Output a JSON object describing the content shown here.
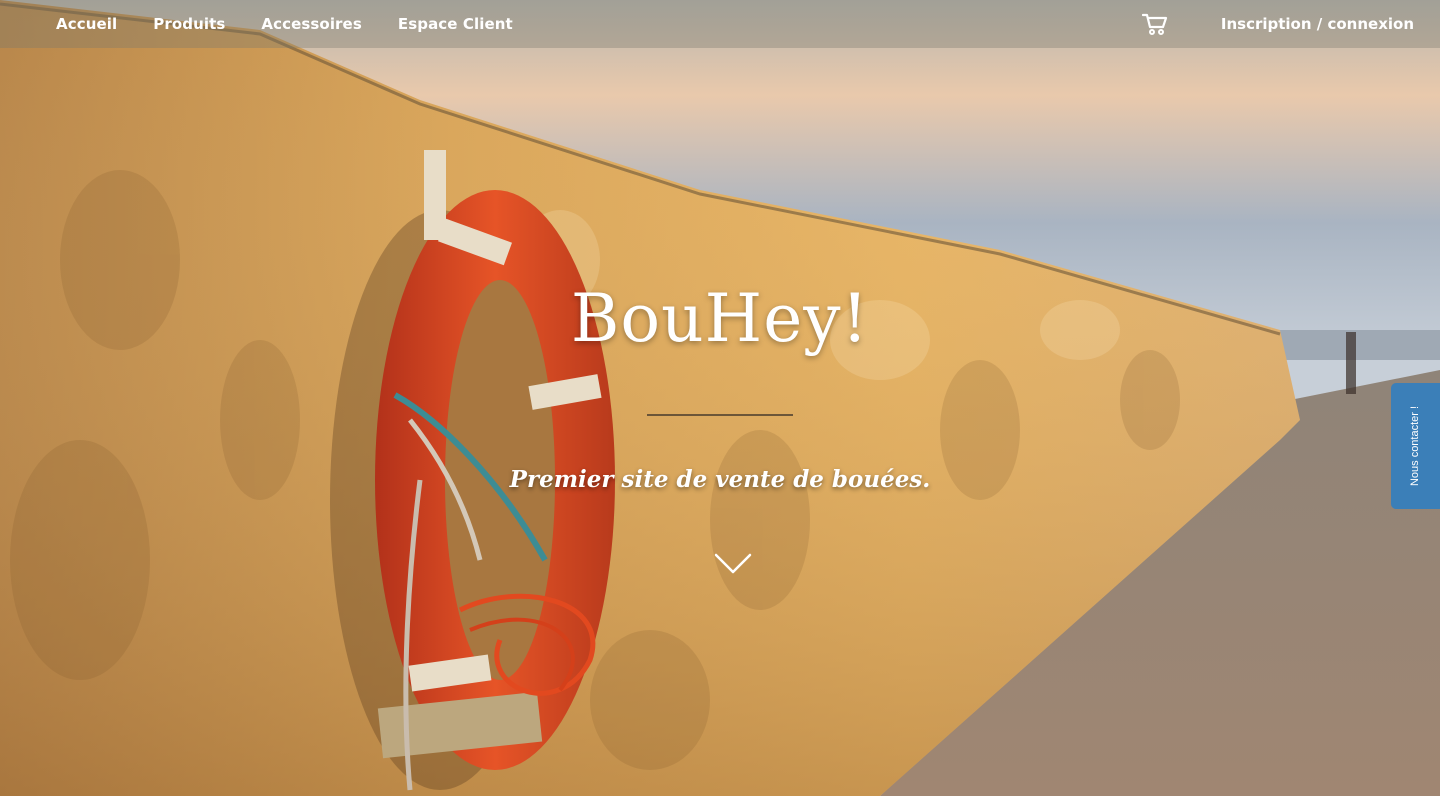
{
  "nav": {
    "items": [
      {
        "label": "Accueil"
      },
      {
        "label": "Produits"
      },
      {
        "label": "Accessoires"
      },
      {
        "label": "Espace Client"
      }
    ],
    "cart_icon": "shopping-cart-icon",
    "login_label": "Inscription / connexion"
  },
  "hero": {
    "title": "BouHey!",
    "subtitle": "Premier site de vente de bouées.",
    "scroll_icon": "chevron-down-icon"
  },
  "contact_tab": {
    "label": "Nous contacter !"
  },
  "colors": {
    "accent_blue": "#3b7fb8",
    "lifebuoy_orange": "#e2491f",
    "wall_sand": "#d9a55a"
  }
}
